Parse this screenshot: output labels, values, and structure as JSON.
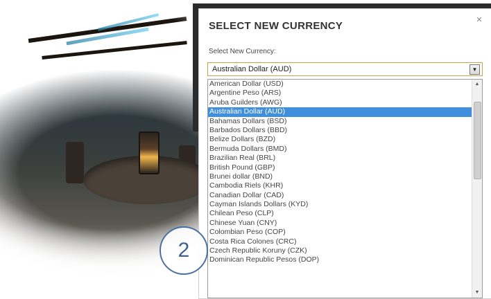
{
  "dialog": {
    "title": "SELECT NEW CURRENCY",
    "close_icon": "close-icon",
    "field_label": "Select New Currency:",
    "selected_value": "Australian Dollar (AUD)"
  },
  "dropdown": {
    "options": [
      "American Dollar (USD)",
      "Argentine Peso (ARS)",
      "Aruba Guilders (AWG)",
      "Australian Dollar (AUD)",
      "Bahamas Dollars (BSD)",
      "Barbados Dollars (BBD)",
      "Belize Dollars (BZD)",
      "Bermuda Dollars (BMD)",
      "Brazilian Real (BRL)",
      "British Pound (GBP)",
      "Brunei dollar (BND)",
      "Cambodia Riels (KHR)",
      "Canadian Dollar (CAD)",
      "Cayman Islands Dollars (KYD)",
      "Chilean Peso (CLP)",
      "Chinese Yuan (CNY)",
      "Colombian Peso (COP)",
      "Costa Rica Colones (CRC)",
      "Czech Republic Koruny (CZK)",
      "Dominican Republic Pesos (DOP)"
    ],
    "highlighted_index": 3,
    "highlight_color": "#3f8fdd"
  },
  "annotation": {
    "step_number": "2",
    "circle_color": "#4a6fa5"
  }
}
